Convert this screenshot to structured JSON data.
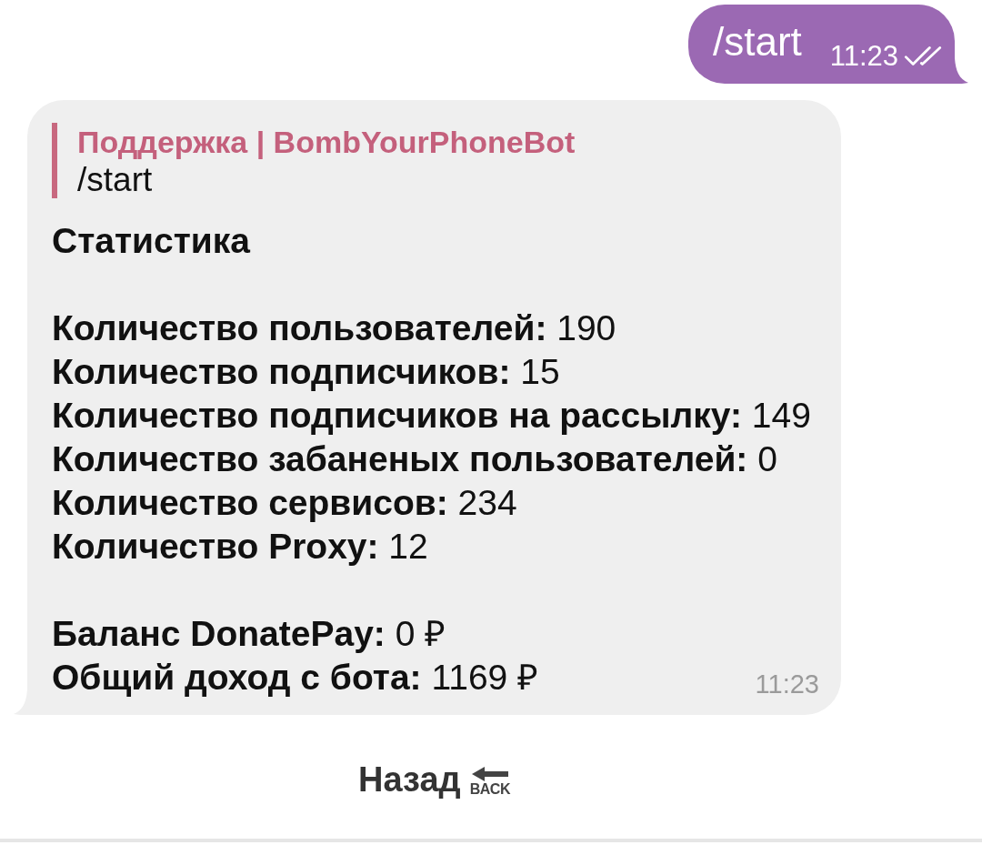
{
  "outgoing": {
    "text": "/start",
    "time": "11:23",
    "read": true
  },
  "incoming": {
    "reply": {
      "author": "Поддержка | BombYourPhoneBot",
      "text": "/start"
    },
    "title": "Статистика",
    "stats": [
      "**Количество пользователей:** 190",
      "**Количество подписчиков:** 15",
      "**Количество подписчиков на рассылку:** 149",
      "**Количество забаненых пользователей:** 0",
      "**Количество сервисов:** 234",
      "**Количество Proxy:** 12"
    ],
    "balance": [
      "**Баланс DonatePay:** 0 ₽",
      "**Общий доход с бота:** 1169 ₽"
    ],
    "time": "11:23"
  },
  "keyboard": [
    {
      "label": "Назад",
      "emoji_text": "BACK"
    }
  ]
}
